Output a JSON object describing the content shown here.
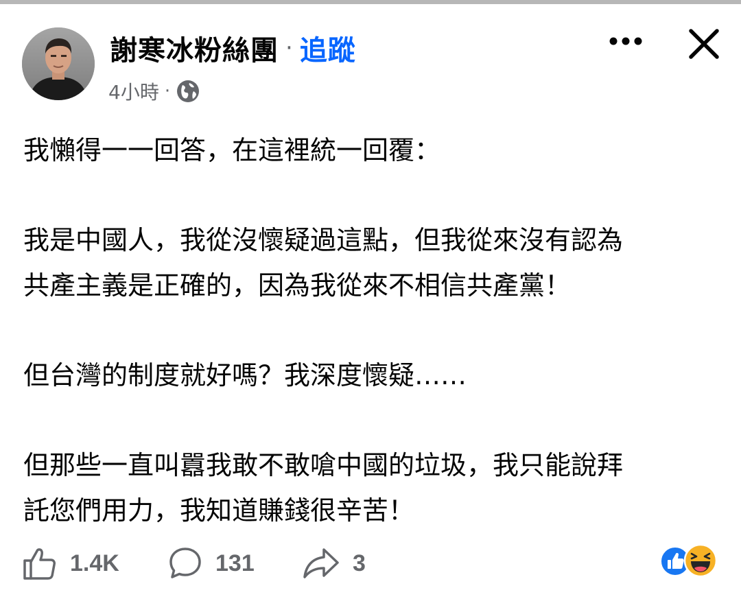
{
  "post": {
    "page_name": "謝寒冰粉絲團",
    "separator": "·",
    "follow_label": "追蹤",
    "time": "4小時",
    "meta_separator": "·",
    "privacy_icon": "globe-icon",
    "paragraphs": [
      "我懶得一一回答，在這裡統一回覆：",
      "我是中國人，我從沒懷疑過這點，但我從來沒有認為\n共產主義是正確的，因為我從來不相信共產黨！",
      "但台灣的制度就好嗎？我深度懷疑……",
      "但那些一直叫囂我敢不敢嗆中國的垃圾，我只能說拜\n託您們用力，我知道賺錢很辛苦！"
    ]
  },
  "actions": {
    "like_count": "1.4K",
    "comment_count": "131",
    "share_count": "3"
  },
  "reactions": [
    "like-reaction-icon",
    "haha-reaction-icon"
  ],
  "colors": {
    "follow": "#0866ff",
    "secondary_text": "#65676b",
    "primary_text": "#050505",
    "like_blue": "#1877f2",
    "haha_yellow": "#f7b125"
  }
}
